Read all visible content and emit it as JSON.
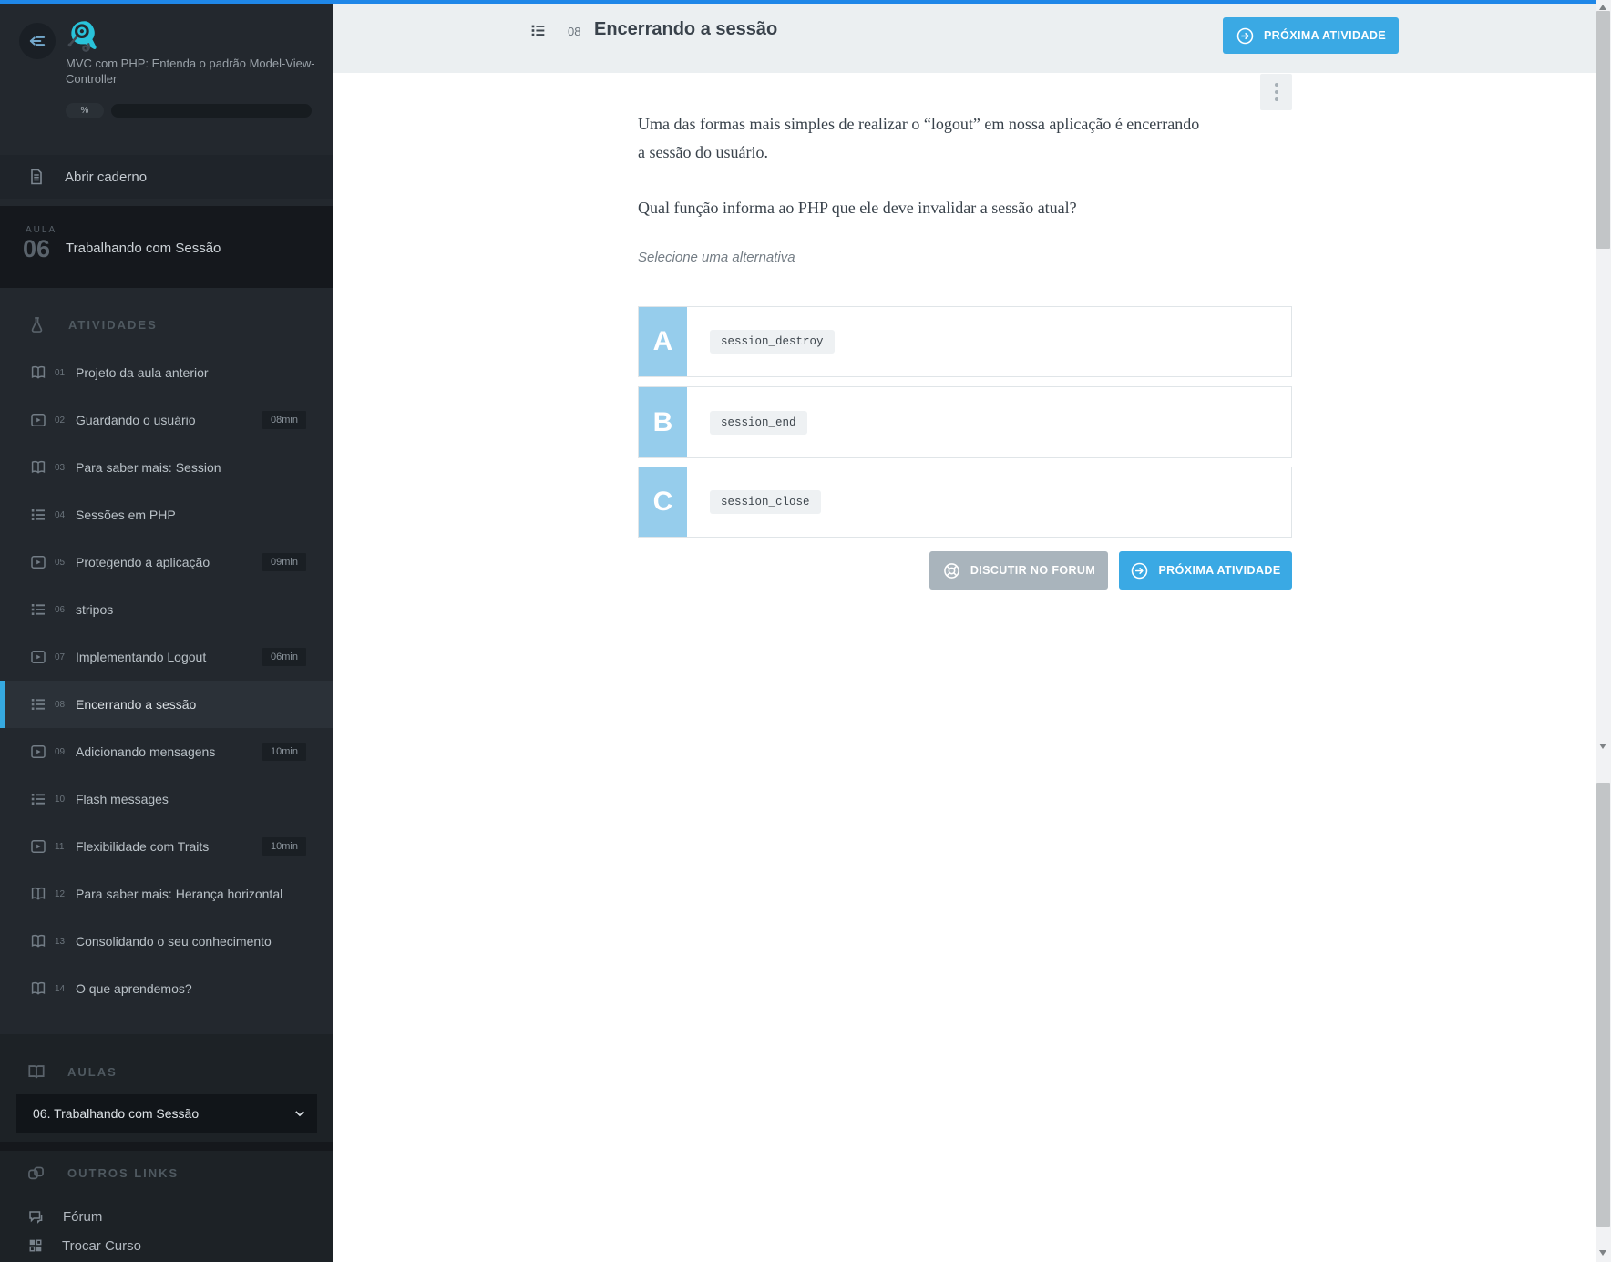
{
  "sidebar": {
    "course_title": "MVC com PHP: Entenda o padrão Model-View-Controller",
    "progress_percent_label": "%",
    "notebook_label": "Abrir caderno",
    "lesson": {
      "tag": "AULA",
      "number": "06",
      "title": "Trabalhando com Sessão"
    },
    "activities_header": "ATIVIDADES",
    "activities": [
      {
        "num": "01",
        "label": "Projeto da aula anterior",
        "icon": "book",
        "duration": ""
      },
      {
        "num": "02",
        "label": "Guardando o usuário",
        "icon": "video",
        "duration": "08min"
      },
      {
        "num": "03",
        "label": "Para saber mais: Session",
        "icon": "book",
        "duration": ""
      },
      {
        "num": "04",
        "label": "Sessões em PHP",
        "icon": "list",
        "duration": ""
      },
      {
        "num": "05",
        "label": "Protegendo a aplicação",
        "icon": "video",
        "duration": "09min"
      },
      {
        "num": "06",
        "label": "stripos",
        "icon": "list",
        "duration": ""
      },
      {
        "num": "07",
        "label": "Implementando Logout",
        "icon": "video",
        "duration": "06min"
      },
      {
        "num": "08",
        "label": "Encerrando a sessão",
        "icon": "list",
        "duration": "",
        "active": true
      },
      {
        "num": "09",
        "label": "Adicionando mensagens",
        "icon": "video",
        "duration": "10min"
      },
      {
        "num": "10",
        "label": "Flash messages",
        "icon": "list",
        "duration": ""
      },
      {
        "num": "11",
        "label": "Flexibilidade com Traits",
        "icon": "video",
        "duration": "10min"
      },
      {
        "num": "12",
        "label": "Para saber mais: Herança horizontal",
        "icon": "book",
        "duration": ""
      },
      {
        "num": "13",
        "label": "Consolidando o seu conhecimento",
        "icon": "book",
        "duration": ""
      },
      {
        "num": "14",
        "label": "O que aprendemos?",
        "icon": "book",
        "duration": ""
      }
    ],
    "aulas_header": "AULAS",
    "aulas_selected": "06. Trabalhando com Sessão",
    "other_links_header": "OUTROS LINKS",
    "forum_label": "Fórum",
    "trocar_label": "Trocar Curso"
  },
  "header": {
    "activity_number": "08",
    "title": "Encerrando a sessão",
    "next_button_label": "PRÓXIMA ATIVIDADE"
  },
  "question": {
    "paragraph1": "Uma das formas mais simples de realizar o “logout” em nossa aplicação é encerrando a sessão do usuário.",
    "paragraph2": "Qual função informa ao PHP que ele deve invalidar a sessão atual?",
    "instruction": "Selecione uma alternativa",
    "options": [
      {
        "letter": "A",
        "code": "session_destroy"
      },
      {
        "letter": "B",
        "code": "session_end"
      },
      {
        "letter": "C",
        "code": "session_close"
      }
    ],
    "forum_button_label": "DISCUTIR NO FORUM",
    "next_button_label": "PRÓXIMA ATIVIDADE"
  },
  "colors": {
    "accent_blue": "#3aa9e4",
    "top_strip_blue": "#1f87e8",
    "sidebar_bg": "#23282e",
    "active_item_border": "#36a9e0",
    "option_letter_bg": "#96cdec",
    "header_bar_bg": "#ebeff1",
    "forum_button_bg": "#a9b4bc",
    "logo_cyan": "#29c3da"
  }
}
